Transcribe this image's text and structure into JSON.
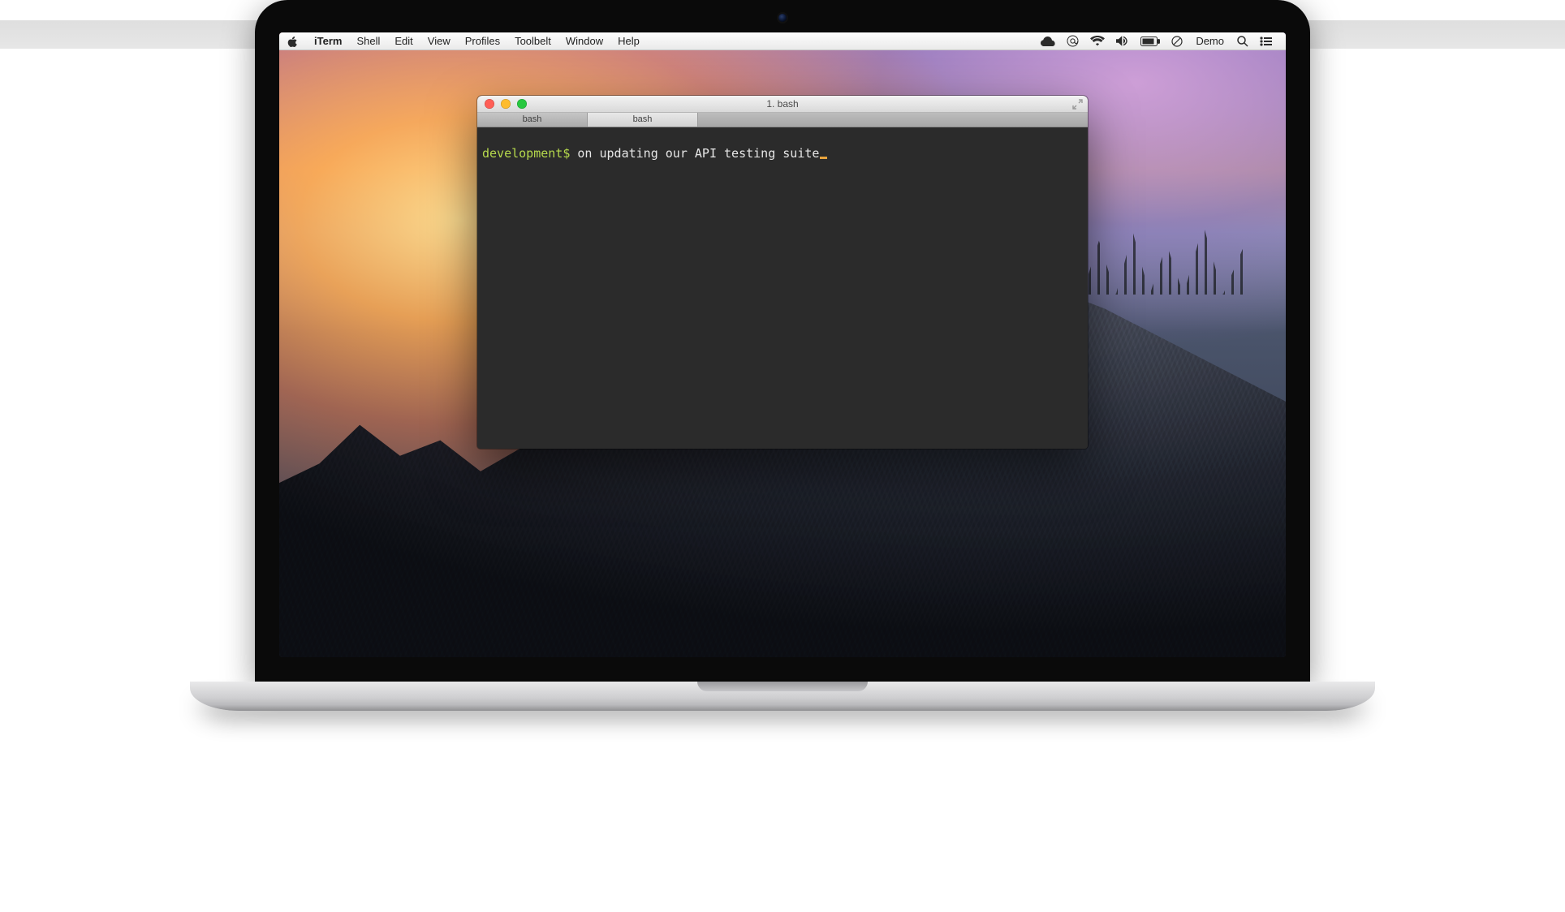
{
  "menubar": {
    "app": "iTerm",
    "items": [
      "Shell",
      "Edit",
      "View",
      "Profiles",
      "Toolbelt",
      "Window",
      "Help"
    ],
    "right_label": "Demo"
  },
  "terminal": {
    "window_title": "1. bash",
    "tabs": [
      {
        "label": "bash",
        "active": false
      },
      {
        "label": "bash",
        "active": true
      }
    ],
    "prompt": "development$",
    "command": " on updating our API testing suite"
  }
}
